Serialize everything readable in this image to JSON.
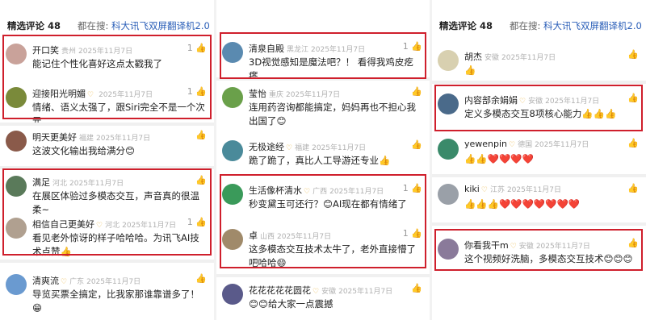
{
  "panels": [
    {
      "header": {
        "title": "精选评论 48",
        "search_prefix": "都在搜:",
        "search_query": "科大讯飞双屏翻译机2.0"
      },
      "comments": [
        {
          "name": "开口笑",
          "loc": "贵州",
          "date": "2025年11月7日",
          "vip": "",
          "likes": "1",
          "text": "能记住个性化喜好这点太戳我了"
        },
        {
          "name": "迎接阳光明媚",
          "loc": "",
          "date": "2025年11月7日",
          "vip": "♡",
          "likes": "1",
          "text": "情绪、语义太强了，跟Siri完全不是一个次元"
        },
        {
          "name": "明天更美好",
          "loc": "福建",
          "date": "2025年11月7日",
          "vip": "",
          "likes": "",
          "text": "这波文化输出我给满分😊"
        },
        {
          "name": "满足",
          "loc": "河北",
          "date": "2025年11月7日",
          "vip": "",
          "likes": "",
          "text": "在展区体验过多模态交互，声音真的很温柔~"
        },
        {
          "name": "相信自己更美好",
          "loc": "河北",
          "date": "2025年11月7日",
          "vip": "♡",
          "likes": "1",
          "text": "看见老外惊讶的样子哈哈哈。为讯飞AI技术点赞👍"
        },
        {
          "name": "清爽流",
          "loc": "广东",
          "date": "2025年11月7日",
          "vip": "♡",
          "likes": "",
          "text": "导览买票全搞定，比我家那谁靠谱多了！😁"
        }
      ]
    },
    {
      "comments": [
        {
          "name": "清泉自殿",
          "loc": "黑龙江",
          "date": "2025年11月7日",
          "vip": "",
          "likes": "1",
          "text": "3D视觉感知是魔法吧？！ 看得我鸡皮疙瘩"
        },
        {
          "name": "莹怡",
          "loc": "重庆",
          "date": "2025年11月7日",
          "vip": "",
          "likes": "",
          "text": "连用药咨询都能搞定，妈妈再也不担心我出国了😊"
        },
        {
          "name": "无极途经",
          "loc": "福建",
          "date": "2025年11月7日",
          "vip": "♡",
          "likes": "",
          "text": "跪了跪了，真比人工导游还专业👍"
        },
        {
          "name": "生活像杯清水",
          "loc": "广西",
          "date": "2025年11月7日",
          "vip": "♡",
          "likes": "1",
          "text": "秒变黛玉可还行？😊AI现在都有情绪了"
        },
        {
          "name": "卓",
          "loc": "山西",
          "date": "2025年11月7日",
          "vip": "",
          "likes": "1",
          "text": "这多模态交互技术太牛了，老外直接懵了吧哈哈😄"
        },
        {
          "name": "花花花花花圆花",
          "loc": "安徽",
          "date": "2025年11月7日",
          "vip": "♡",
          "likes": "",
          "text": "😊😊给大家一点震撼"
        }
      ]
    },
    {
      "header": {
        "title": "精选评论 48",
        "search_prefix": "都在搜:",
        "search_query": "科大讯飞双屏翻译机2.0"
      },
      "comments": [
        {
          "name": "胡杰",
          "loc": "安徽",
          "date": "2025年11月7日",
          "vip": "",
          "likes": "",
          "text": "👍"
        },
        {
          "name": "内容部余娟娟",
          "loc": "安徽",
          "date": "2025年11月7日",
          "vip": "♡",
          "likes": "",
          "text": "定义多模态交互8项核心能力👍👍👍"
        },
        {
          "name": "yewenpin",
          "loc": "德国",
          "date": "2025年11月7日",
          "vip": "♡",
          "likes": "",
          "text": "👍👍❤️❤️❤️❤️"
        },
        {
          "name": "kiki",
          "loc": "江苏",
          "date": "2025年11月7日",
          "vip": "♡",
          "likes": "",
          "text": "👍👍👍❤️❤️❤️❤️❤️❤️❤️"
        },
        {
          "name": "你看我干m",
          "loc": "安徽",
          "date": "2025年11月7日",
          "vip": "♡",
          "likes": "",
          "text": "这个视频好洗脑，多模态交互技术😊😊😊"
        }
      ]
    }
  ],
  "colors": {
    "highlight": "#cf1f2c",
    "search_query": "#2b5fb8",
    "vip": "#e9b23a"
  }
}
